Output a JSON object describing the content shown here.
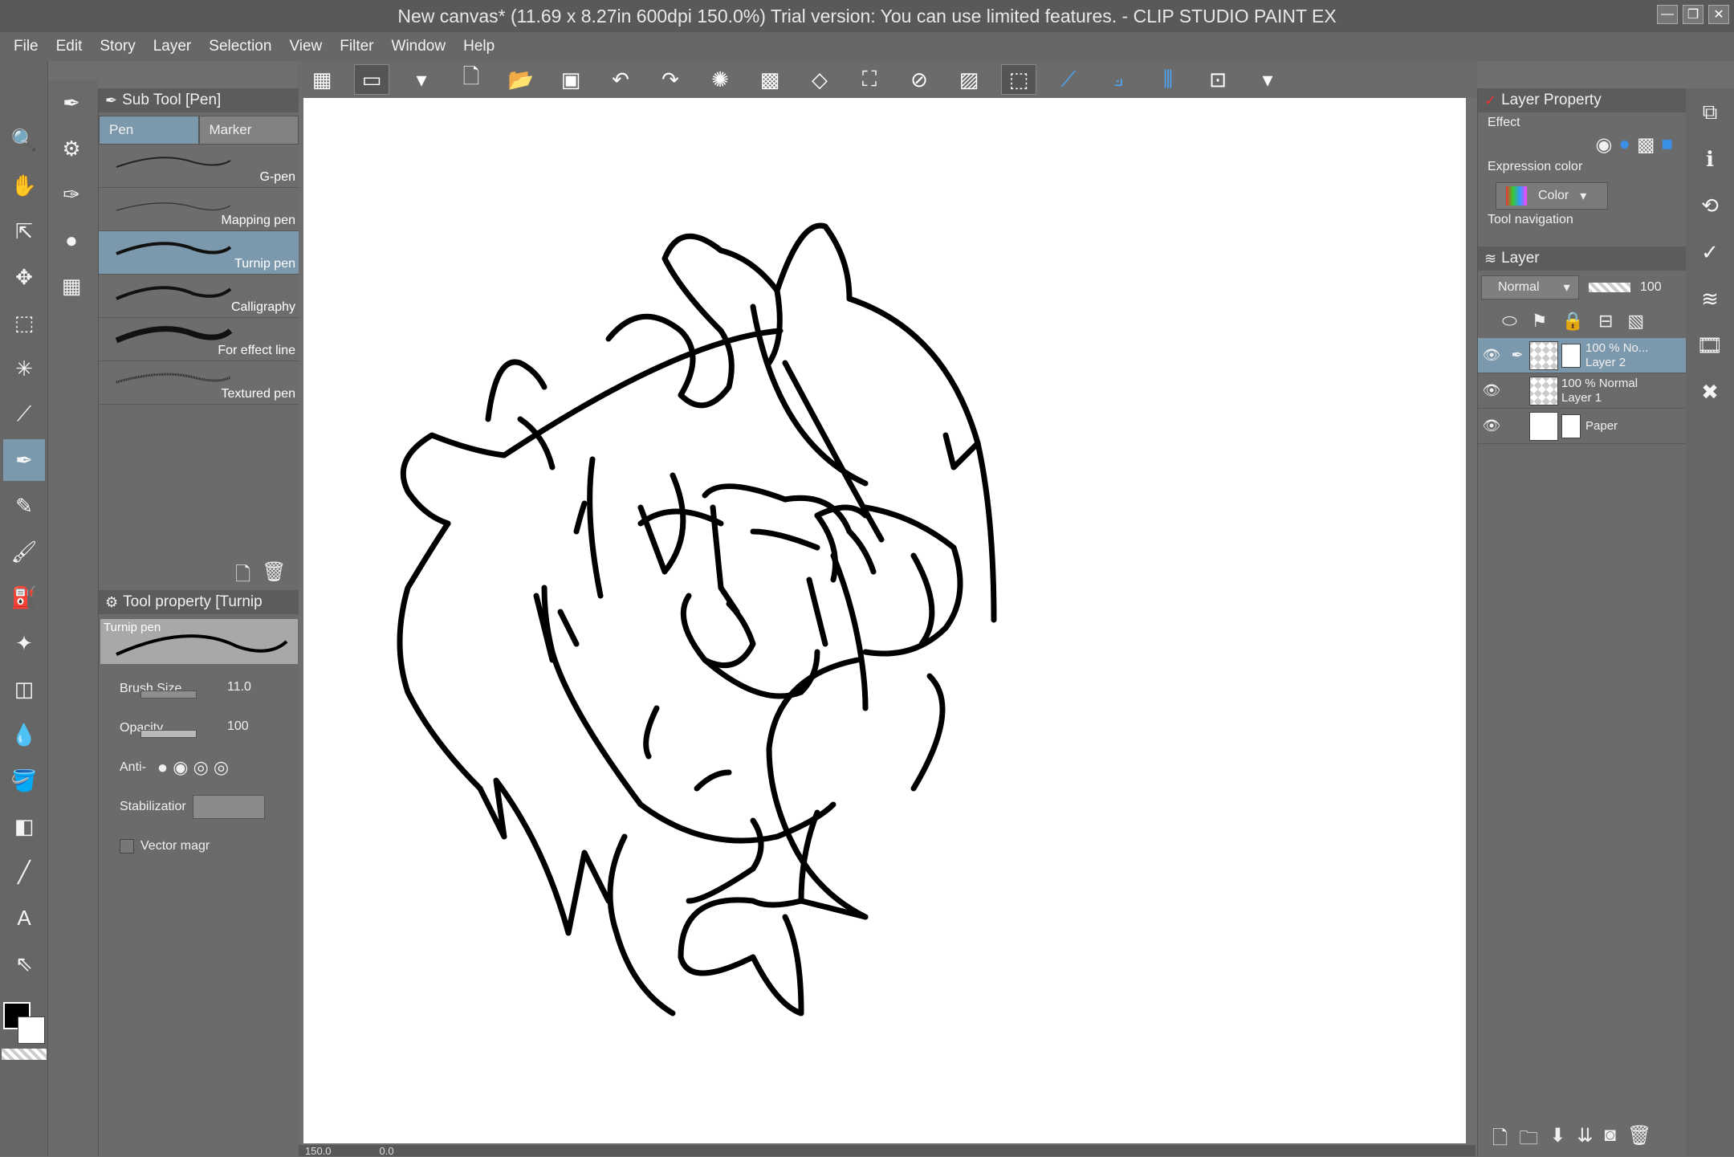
{
  "window": {
    "title": "New canvas* (11.69 x 8.27in 600dpi 150.0%)  Trial version: You can use limited features. - CLIP STUDIO PAINT EX",
    "controls": [
      "—",
      "❐",
      "✕"
    ]
  },
  "menu": [
    "File",
    "Edit",
    "Story",
    "Layer",
    "Selection",
    "View",
    "Filter",
    "Window",
    "Help"
  ],
  "subtool": {
    "title": "Sub Tool [Pen]",
    "tabs": [
      "Pen",
      "Marker"
    ],
    "brushes": [
      "G-pen",
      "Mapping pen",
      "Turnip pen",
      "Calligraphy",
      "For effect line",
      "Textured pen"
    ],
    "selected_brush": "Turnip pen"
  },
  "toolprop": {
    "title": "Tool property [Turnip",
    "preview_label": "Turnip pen",
    "brush_size_label": "Brush Size",
    "brush_size_value": "11.0",
    "opacity_label": "Opacity",
    "opacity_value": "100",
    "anti_label": "Anti-",
    "stabilization_label": "Stabilizatior",
    "vector_label": "Vector magr"
  },
  "layer_property": {
    "title": "Layer Property",
    "effect_label": "Effect",
    "expression_label": "Expression color",
    "expression_value": "Color",
    "tool_nav_label": "Tool navigation"
  },
  "layer_panel": {
    "title": "Layer",
    "blend_mode": "Normal",
    "opacity": "100",
    "layers": [
      {
        "line1": "100 %  No...",
        "line2": "Layer 2",
        "selected": true
      },
      {
        "line1": "100 %  Normal",
        "line2": "Layer 1",
        "selected": false
      },
      {
        "line1": "",
        "line2": "Paper",
        "selected": false
      }
    ]
  },
  "status": {
    "zoom": "150.0",
    "angle": "0.0"
  },
  "colors": {
    "main": "#000000",
    "sub": "#ffffff",
    "selection": "#7b98ac"
  }
}
